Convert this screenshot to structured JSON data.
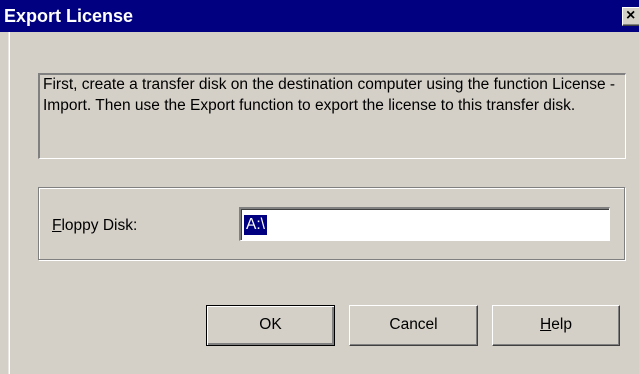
{
  "window": {
    "title": "Export License"
  },
  "info": {
    "text": "First, create a transfer disk on the destination computer using the function License - Import. Then use the Export function to export the license to this transfer disk."
  },
  "floppy": {
    "label_mnemonic": "F",
    "label_rest": "loppy Disk:",
    "value": "A:\\"
  },
  "buttons": {
    "ok_label": "OK",
    "cancel_label": "Cancel",
    "help_mnemonic": "H",
    "help_rest": "elp"
  },
  "icons": {
    "close": "close-icon"
  },
  "colors": {
    "titlebar": "#000080",
    "dialog_face": "#d4d0c8",
    "selection": "#000080"
  }
}
